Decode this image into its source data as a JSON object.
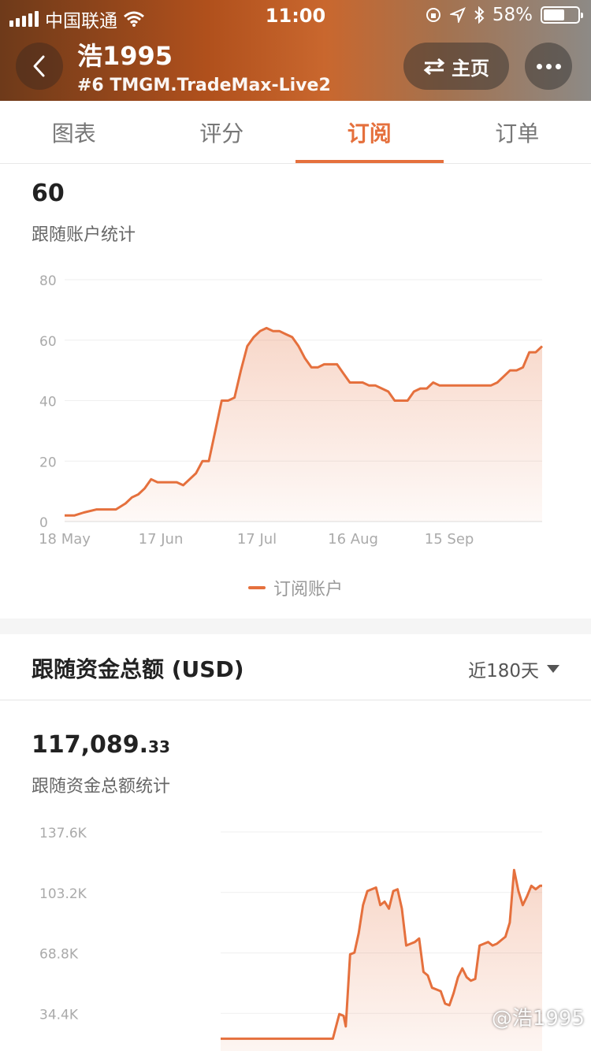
{
  "status_bar": {
    "carrier": "中国联通",
    "time": "11:00",
    "battery": "58%"
  },
  "header": {
    "account_name": "浩1995",
    "account_sub": "#6 TMGM.TradeMax-Live2",
    "home_label": "主页",
    "back_icon": "chevron-left-icon",
    "more_icon": "more-dots-icon"
  },
  "tabs": [
    {
      "label": "图表",
      "active": false
    },
    {
      "label": "评分",
      "active": false
    },
    {
      "label": "订阅",
      "active": true
    },
    {
      "label": "订单",
      "active": false
    }
  ],
  "followers_section": {
    "value": "60",
    "caption": "跟随账户统计",
    "legend": "订阅账户"
  },
  "funds_section": {
    "title": "跟随资金总额 (USD)",
    "period": "近180天",
    "amount_int": "117,089.",
    "amount_dec": "33",
    "caption": "跟随资金总额统计"
  },
  "watermark": "@浩1995",
  "colors": {
    "accent": "#e5703d",
    "fill": "#fde8de"
  },
  "chart_data": [
    {
      "type": "area",
      "series": [
        {
          "name": "订阅账户",
          "x": [
            0,
            3,
            6,
            10,
            13,
            16,
            19,
            21,
            23,
            25,
            27,
            29,
            31,
            33,
            35,
            37,
            39,
            41,
            43,
            45,
            47,
            49,
            51,
            53,
            55,
            57,
            59,
            61,
            63,
            65,
            67,
            69,
            71,
            73,
            75,
            77,
            79,
            81,
            83,
            85,
            87,
            89,
            91,
            93,
            95,
            97,
            99,
            101,
            103,
            105,
            107,
            109,
            111,
            113,
            115,
            117,
            119,
            121,
            123,
            125,
            127,
            129,
            131,
            133,
            135,
            137,
            139,
            141,
            143,
            145,
            147,
            149
          ],
          "values": [
            2,
            2,
            3,
            4,
            4,
            4,
            6,
            8,
            9,
            11,
            14,
            13,
            13,
            13,
            13,
            12,
            14,
            16,
            20,
            20,
            30,
            40,
            40,
            41,
            50,
            58,
            61,
            63,
            64,
            63,
            63,
            62,
            61,
            58,
            54,
            51,
            51,
            52,
            52,
            52,
            49,
            46,
            46,
            46,
            45,
            45,
            44,
            43,
            40,
            40,
            40,
            43,
            44,
            44,
            46,
            45,
            45,
            45,
            45,
            45,
            45,
            45,
            45,
            45,
            46,
            48,
            50,
            50,
            51,
            56,
            56,
            58
          ]
        }
      ],
      "x_tick_labels": [
        "18 May",
        "17 Jun",
        "17 Jul",
        "16 Aug",
        "15 Sep"
      ],
      "x_tick_positions": [
        0,
        30,
        60,
        90,
        120
      ],
      "ylim": [
        0,
        80
      ],
      "y_ticks": [
        "0",
        "20",
        "40",
        "60",
        "80"
      ],
      "y_tick_values": [
        0,
        20,
        40,
        60,
        80
      ],
      "grid": true,
      "legend": "bottom-center"
    },
    {
      "type": "area",
      "series": [
        {
          "name": "跟随资金总额",
          "x": [
            0,
            52,
            55,
            57,
            58,
            60,
            62,
            64,
            66,
            68,
            70,
            72,
            74,
            76,
            78,
            80,
            82,
            84,
            86,
            88,
            90,
            92,
            94,
            96,
            98,
            100,
            102,
            104,
            106,
            108,
            110,
            112,
            114,
            116,
            118,
            120,
            122,
            124,
            126,
            128,
            130,
            132,
            134,
            136,
            138,
            140,
            142,
            144,
            146,
            148,
            149
          ],
          "values": [
            20000,
            20000,
            34000,
            33000,
            27000,
            68000,
            69000,
            80000,
            96000,
            104000,
            105000,
            106000,
            96000,
            98000,
            94000,
            104000,
            105000,
            94000,
            73000,
            74000,
            75000,
            77000,
            58000,
            56000,
            49000,
            48000,
            47000,
            40000,
            39000,
            46000,
            55000,
            60000,
            55000,
            53000,
            54000,
            73000,
            74000,
            75000,
            73000,
            74000,
            76000,
            78000,
            86000,
            116000,
            104000,
            96000,
            101000,
            107000,
            105000,
            107000,
            107000
          ]
        }
      ],
      "y_ticks": [
        "34.4K",
        "68.8K",
        "103.2K",
        "137.6K"
      ],
      "y_tick_values": [
        34400,
        68800,
        103200,
        137600
      ],
      "ylim": [
        0,
        137600
      ],
      "grid": true
    }
  ]
}
